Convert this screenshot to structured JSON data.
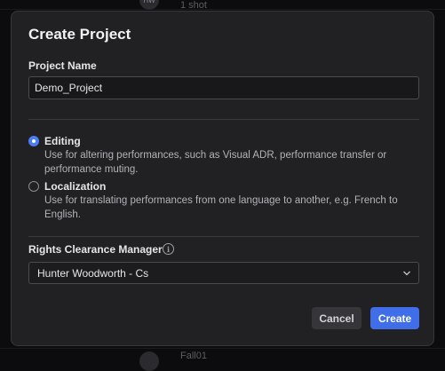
{
  "background": {
    "top_avatar_initials": "HW",
    "top_row_text": "1 shot",
    "bottom_row_text": "Fall01"
  },
  "dialog": {
    "title": "Create Project",
    "project_name_label": "Project Name",
    "project_name_value": "Demo_Project",
    "options": [
      {
        "title": "Editing",
        "description": "Use for altering performances, such as Visual ADR, performance transfer or performance muting.",
        "selected": true
      },
      {
        "title": "Localization",
        "description": "Use for translating performances from one language to another, e.g. French to English.",
        "selected": false
      }
    ],
    "rights_label": "Rights Clearance Manager",
    "info_icon_glyph": "i",
    "rights_selected": "Hunter Woodworth - Cs",
    "cancel_label": "Cancel",
    "create_label": "Create"
  },
  "colors": {
    "accent": "#3f6ee8",
    "modal_bg": "#212124",
    "page_bg": "#0c0c0e"
  },
  "icons": [
    "info-icon",
    "chevron-down-icon",
    "radio-selected-icon",
    "radio-unselected-icon"
  ]
}
